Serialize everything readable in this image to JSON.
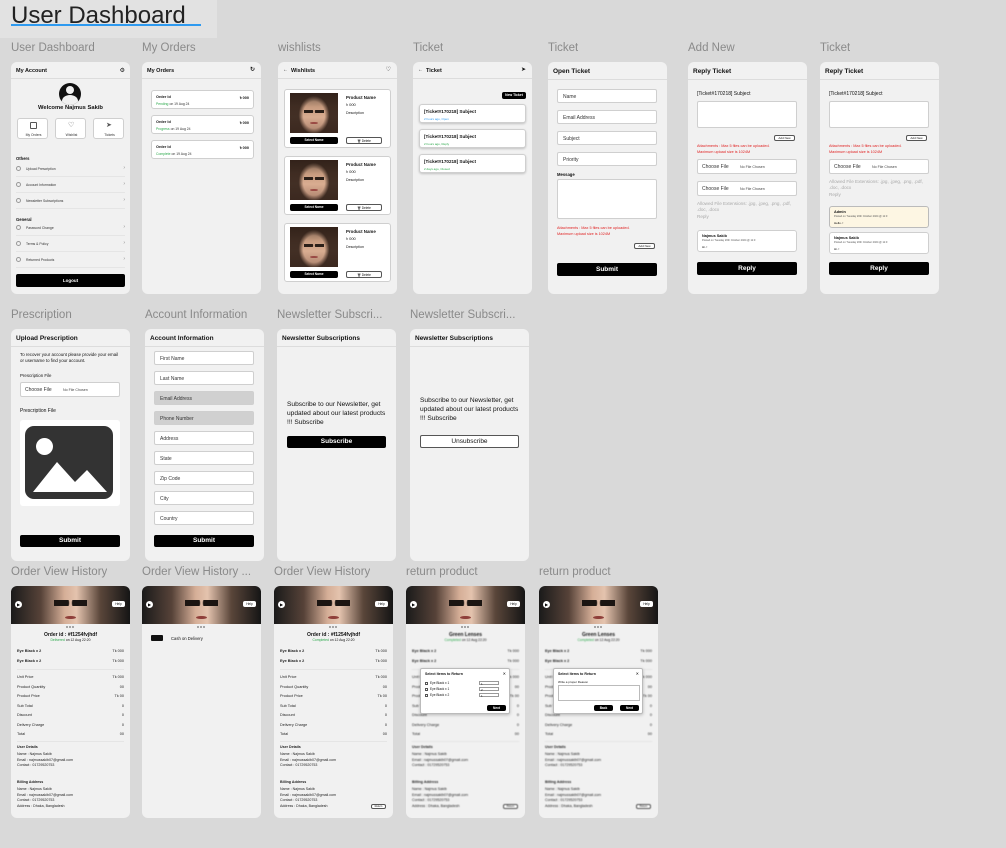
{
  "page_title": "User Dashboard",
  "labels": {
    "f1": "User Dashboard",
    "f2": "My Orders",
    "f3": "wishlists",
    "f4": "Ticket",
    "f5": "Ticket",
    "f6": "Add New",
    "f7": "Ticket",
    "f8": "Prescription",
    "f9": "Account Information",
    "f10": "Newsletter Subscri...",
    "f11": "Newsletter Subscri...",
    "f12": "Order View History",
    "f13": "Order View History ...",
    "f14": "Order View History",
    "f15": "return product",
    "f16": "return product"
  },
  "dashboard": {
    "header": "My Account",
    "welcome": "Welcome Najmus Sakib",
    "quick": [
      "My Orders",
      "Wishlist",
      "Tickets"
    ],
    "others_title": "Others",
    "others": [
      "Upload Prescription",
      "Account Information",
      "Newsletter Subscriptions"
    ],
    "general_title": "General",
    "general": [
      "Password Change",
      "Terms & Policy",
      "Returned Products"
    ],
    "logout": "Logout"
  },
  "orders": {
    "header": "My Orders",
    "items": [
      {
        "id": "Order Id",
        "price": "৳ 000",
        "status": "Pending",
        "date": "on 19 Aug 24",
        "color": "#2aa84a"
      },
      {
        "id": "Order Id",
        "price": "৳ 000",
        "status": "Progress",
        "date": "on 19 Aug 24",
        "color": "#2aa84a"
      },
      {
        "id": "Order Id",
        "price": "৳ 000",
        "status": "Complete",
        "date": "on 19 Aug 24",
        "color": "#2aa84a"
      }
    ]
  },
  "wishlist": {
    "header": "Wishlists",
    "items": [
      {
        "name": "Product Name",
        "price": "৳ 000",
        "desc": "Description",
        "select": "Select Name",
        "delete": "Delete"
      },
      {
        "name": "Product Name",
        "price": "৳ 000",
        "desc": "Description",
        "select": "Select Name",
        "delete": "Delete"
      },
      {
        "name": "Product Name",
        "price": "৳ 000",
        "desc": "Description",
        "select": "Select Name",
        "delete": "Delete"
      }
    ]
  },
  "ticket_list": {
    "header": "Ticket",
    "new_ticket": "New Ticket",
    "items": [
      {
        "subject": "[Ticket#170218] Subject",
        "meta": "2 hours ago, Open"
      },
      {
        "subject": "[Ticket#170218] Subject",
        "meta": "2 hours ago, Reply"
      },
      {
        "subject": "[Ticket#170218] Subject",
        "meta": "2 days ago, Closed"
      }
    ]
  },
  "open_ticket": {
    "header": "Open Ticket",
    "fields": [
      "Name",
      "Email Address",
      "Subject",
      "Priority"
    ],
    "message": "Message",
    "attach": "Attachments : Max 5 files can be uploaded.",
    "attach2": "Maximum upload size is 1024M",
    "add_new": "Add New",
    "submit": "Submit"
  },
  "reply1": {
    "header": "Reply Ticket",
    "subject": "[Ticket#170218] Subject",
    "add_new": "Add New",
    "attach": "Attachments : Max 5 files can be uploaded.",
    "attach2": "Maximum upload size is 1024M",
    "choose": "Choose File",
    "nofile": "No File Chosen",
    "allowed": "Allowed File Extensions: .jpg, .jpeg, .png, .pdf, .doc, .docx",
    "reply_label": "Reply",
    "user": "Najmus Sakib",
    "user_meta": "Posted on Tuesday 20th October 2024 @ 11:0",
    "user_msg": "Hi..!",
    "reply_btn": "Reply"
  },
  "reply2": {
    "header": "Reply Ticket",
    "subject": "[Ticket#170218] Subject",
    "add_new": "Add New",
    "attach": "Attachments : Max 5 files can be uploaded.",
    "attach2": "Maximum upload size is 1024M",
    "choose": "Choose File",
    "nofile": "No File Chosen",
    "allowed": "Allowed File Extensions: .jpg, .jpeg, .png, .pdf, .doc, .docx",
    "reply_label": "Reply",
    "admin": "Admin",
    "admin_meta": "Posted on Tuesday 20th October 2024 @ 11:0",
    "admin_msg": "Hello..!",
    "user": "Najmus Sakib",
    "user_meta": "Posted on Tuesday 20th October 2024 @ 11:0",
    "user_msg": "Hi..!",
    "reply_btn": "Reply"
  },
  "prescription": {
    "header": "Upload Prescription",
    "note": "To recover your account please provide your email or username to find your account.",
    "file_label": "Prescription File",
    "choose": "Choose File",
    "nofile": "No File Chosen",
    "file_label2": "Prescription File",
    "submit": "Submit"
  },
  "account": {
    "header": "Account Information",
    "fields": [
      "First Name",
      "Last Name",
      "Email Address",
      "Phone Number",
      "Address",
      "State",
      "Zip Code",
      "City",
      "Country"
    ],
    "submit": "Submit"
  },
  "newsletter1": {
    "header": "Newsletter Subscriptions",
    "text": "Subscribe to our Newsletter, get updated about our latest products !!! Subscribe",
    "btn": "Subscribe"
  },
  "newsletter2": {
    "header": "Newsletter Subscriptions",
    "text": "Subscribe to our Newsletter, get updated about our latest products !!! Subscribe",
    "btn": "Unsubscribe"
  },
  "order_view": {
    "order_id": "Order id : #f1254fvjhdf",
    "delivered": "Delivered",
    "completed": "Completed",
    "date": "on 12 Aug 22:20",
    "help": "Help",
    "items": [
      {
        "name": "Eye Black x 2",
        "price": "Tk 000"
      },
      {
        "name": "Eye Black x 2",
        "price": "Tk 000"
      }
    ],
    "summary": [
      {
        "k": "Unit Price",
        "v": "Tk 000"
      },
      {
        "k": "Product Quantity",
        "v": "00"
      },
      {
        "k": "Product Price",
        "v": "Tk 00"
      },
      {
        "k": "Sub Total",
        "v": "0"
      },
      {
        "k": "Discount",
        "v": "0"
      },
      {
        "k": "Delivery Charge",
        "v": "0"
      },
      {
        "k": "Total",
        "v": "00"
      }
    ],
    "user_title": "User Details",
    "user": [
      "Name : Najmus Sakib",
      "Email : najmussakib07@gmail.com",
      "Contact : 01729520753"
    ],
    "billing_title": "Billing Address",
    "billing": [
      "Name : Najmus Sakib",
      "Email : najmussakib07@gmail.com",
      "Contact : 01729520753",
      "Address : Dhaka, Bangladesh"
    ],
    "cod": "Cash on Delivery",
    "return_btn": "Return"
  },
  "return_view": {
    "product": "Green Lenses",
    "completed": "Completed",
    "date": "on 12 Aug 22:20",
    "modal_title": "Select Items to Return",
    "modal_items": [
      {
        "name": "Eye Black x 1",
        "qty": "1"
      },
      {
        "name": "Eye Black x 1",
        "qty": "2"
      },
      {
        "name": "Eye Black x 2",
        "qty": "1"
      }
    ],
    "next": "Next",
    "back": "Back",
    "reason": "Write a proper Reason"
  },
  "colors": {
    "accent": "#2e9af0",
    "success": "#2aa84a",
    "danger": "#e02020",
    "dark": "#000000"
  }
}
